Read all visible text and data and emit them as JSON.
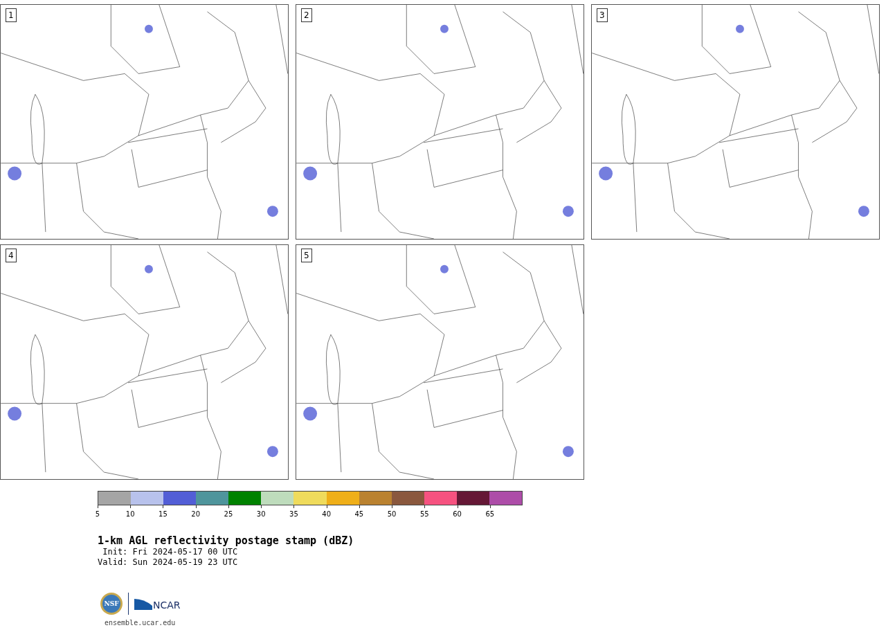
{
  "panels": [
    {
      "label": "1"
    },
    {
      "label": "2"
    },
    {
      "label": "3"
    },
    {
      "label": "4"
    },
    {
      "label": "5"
    }
  ],
  "colorbar": {
    "bins": [
      {
        "label": "5",
        "color": "#a5a5a5"
      },
      {
        "label": "10",
        "color": "#b8c2ec"
      },
      {
        "label": "15",
        "color": "#525ed6"
      },
      {
        "label": "20",
        "color": "#4f959c"
      },
      {
        "label": "25",
        "color": "#008200"
      },
      {
        "label": "30",
        "color": "#bedcbc"
      },
      {
        "label": "35",
        "color": "#efdb5c"
      },
      {
        "label": "40",
        "color": "#efaf19"
      },
      {
        "label": "45",
        "color": "#ba8230"
      },
      {
        "label": "50",
        "color": "#8a583e"
      },
      {
        "label": "55",
        "color": "#f65280"
      },
      {
        "label": "60",
        "color": "#651836"
      },
      {
        "label": "65",
        "color": "#ad4da8"
      }
    ]
  },
  "title": "1-km AGL reflectivity postage stamp (dBZ)",
  "init": " Init: Fri 2024-05-17 00 UTC",
  "valid": "Valid: Sun 2024-05-19 23 UTC",
  "logos": {
    "nsf": "NSF",
    "ncar": "NCAR"
  },
  "website": "ensemble.ucar.edu"
}
